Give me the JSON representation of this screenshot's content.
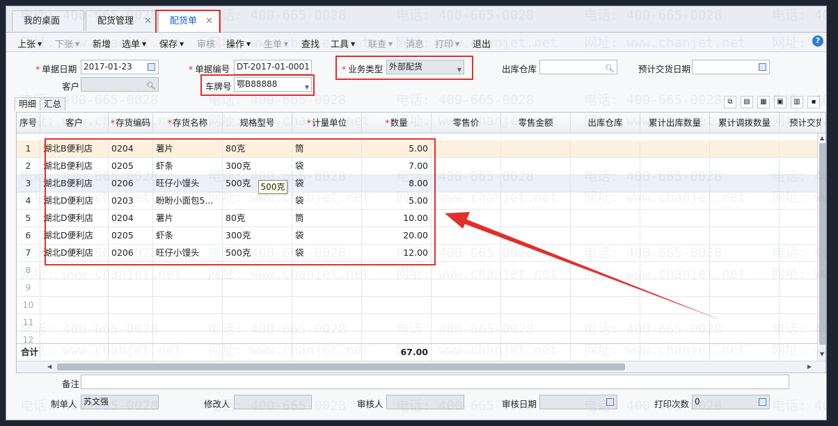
{
  "tabs": [
    {
      "label": "我的桌面",
      "closable": false
    },
    {
      "label": "配货管理",
      "closable": true
    },
    {
      "label": "配货单",
      "closable": true,
      "active": true
    }
  ],
  "toolbar": {
    "items": [
      {
        "label": "上张",
        "dropdown": true,
        "enabled": true
      },
      {
        "label": "下张",
        "dropdown": true,
        "enabled": false
      },
      {
        "label": "新增",
        "dropdown": false,
        "enabled": true
      },
      {
        "label": "选单",
        "dropdown": true,
        "enabled": true
      },
      {
        "label": "保存",
        "dropdown": true,
        "enabled": true
      },
      {
        "label": "审核",
        "dropdown": false,
        "enabled": false
      },
      {
        "label": "操作",
        "dropdown": true,
        "enabled": true
      },
      {
        "label": "生单",
        "dropdown": true,
        "enabled": false
      },
      {
        "label": "查找",
        "dropdown": false,
        "enabled": true
      },
      {
        "label": "工具",
        "dropdown": true,
        "enabled": true
      },
      {
        "label": "联查",
        "dropdown": true,
        "enabled": false
      },
      {
        "label": "消息",
        "dropdown": false,
        "enabled": false
      },
      {
        "label": "打印",
        "dropdown": true,
        "enabled": false
      },
      {
        "label": "退出",
        "dropdown": false,
        "enabled": true
      }
    ],
    "help_icon": "?"
  },
  "header": {
    "date_label": "单据日期",
    "date_value": "2017-01-23",
    "docno_label": "单据编号",
    "docno_value": "DT-2017-01-0001",
    "biztype_label": "业务类型",
    "biztype_value": "外部配货",
    "warehouse_label": "出库仓库",
    "warehouse_value": "",
    "expected_date_label": "预计交货日期",
    "expected_date_value": "",
    "customer_label": "客户",
    "customer_value": "",
    "plate_label": "车牌号",
    "plate_value": "鄂B88888"
  },
  "detail_tabs": [
    "明细",
    "汇总"
  ],
  "grid": {
    "columns": [
      "序号",
      "客户",
      "存货编码",
      "存货名称",
      "规格型号",
      "计量单位",
      "数量",
      "零售价",
      "零售金额",
      "出库仓库",
      "累计出库数量",
      "累计调拨数量",
      "预计交货"
    ],
    "required_columns": [
      "存货编码",
      "存货名称",
      "计量单位",
      "数量"
    ],
    "rows": [
      {
        "seq": "1",
        "customer": "湖北B便利店",
        "code": "0204",
        "name": "薯片",
        "spec": "80克",
        "unit": "筒",
        "qty": "5.00"
      },
      {
        "seq": "2",
        "customer": "湖北B便利店",
        "code": "0205",
        "name": "虾条",
        "spec": "300克",
        "unit": "袋",
        "qty": "7.00"
      },
      {
        "seq": "3",
        "customer": "湖北B便利店",
        "code": "0206",
        "name": "旺仔小馒头",
        "spec": "500克",
        "unit": "袋",
        "qty": "8.00"
      },
      {
        "seq": "4",
        "customer": "湖北D便利店",
        "code": "0203",
        "name": "盼盼小面包5...",
        "spec": "",
        "unit": "袋",
        "qty": "5.00"
      },
      {
        "seq": "5",
        "customer": "湖北D便利店",
        "code": "0204",
        "name": "薯片",
        "spec": "80克",
        "unit": "筒",
        "qty": "10.00"
      },
      {
        "seq": "6",
        "customer": "湖北D便利店",
        "code": "0205",
        "name": "虾条",
        "spec": "300克",
        "unit": "袋",
        "qty": "20.00"
      },
      {
        "seq": "7",
        "customer": "湖北D便利店",
        "code": "0206",
        "name": "旺仔小馒头",
        "spec": "500克",
        "unit": "袋",
        "qty": "12.00"
      }
    ],
    "empty_rows": [
      "8",
      "9",
      "10",
      "11",
      "12"
    ],
    "total_label": "合计",
    "total_qty": "67.00",
    "tooltip": "500克"
  },
  "footer": {
    "remark_label": "备注",
    "remark_value": "",
    "maker_label": "制单人",
    "maker_value": "苏文强",
    "modifier_label": "修改人",
    "modifier_value": "",
    "auditor_label": "审核人",
    "auditor_value": "",
    "audit_date_label": "审核日期",
    "audit_date_value": "",
    "print_count_label": "打印次数",
    "print_count_value": "0"
  },
  "watermark": {
    "phone": "电话: 400-665-0028",
    "site": "网址: www.chanjet.net"
  },
  "colors": {
    "accent": "#1a60c8",
    "annotation": "#e0302c",
    "selected_row": "#fdf1de",
    "hover_row": "#eaf1fb"
  }
}
